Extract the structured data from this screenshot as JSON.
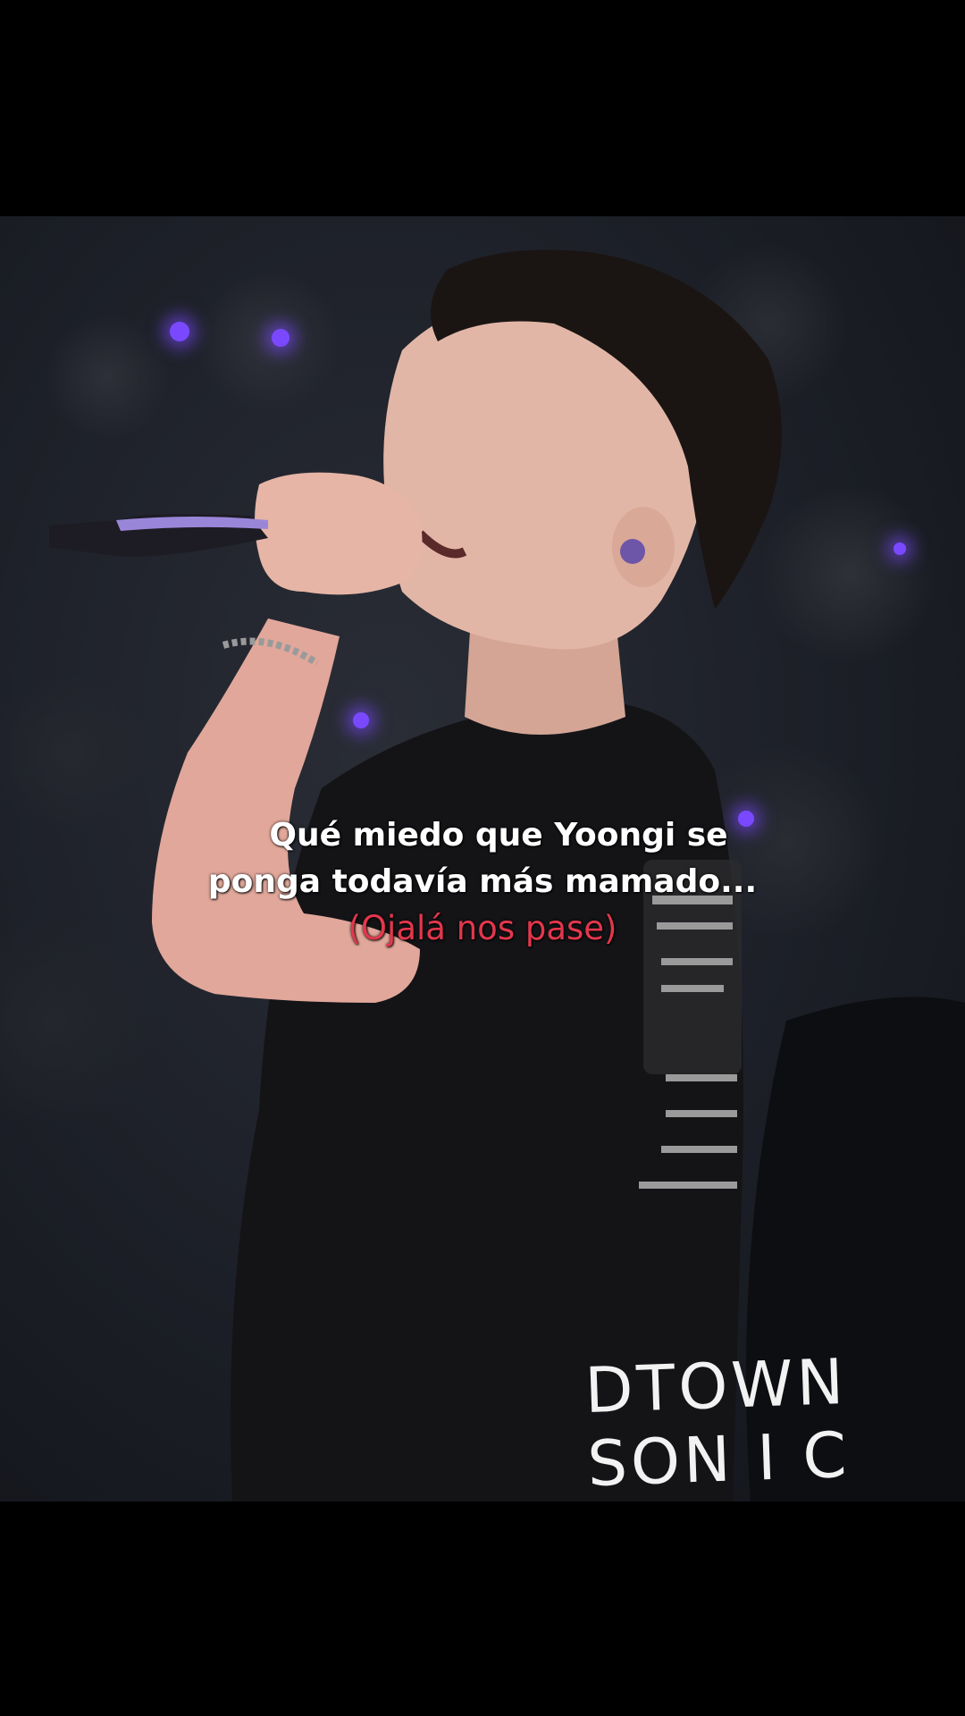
{
  "caption": {
    "line1": "Qué miedo que Yoongi se",
    "line2": "ponga todavía más mamado...",
    "sub": "(Ojalá nos pase)",
    "sub_color": "#e3374c"
  },
  "watermark": {
    "line1": "DTOWN",
    "line2": "SON I C"
  }
}
